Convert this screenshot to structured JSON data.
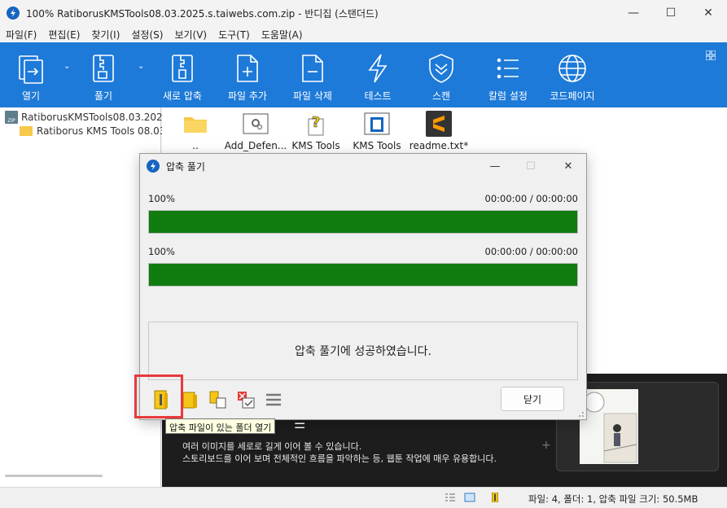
{
  "window": {
    "title": "100% RatiborusKMSTools08.03.2025.s.taiwebs.com.zip - 반디집 (스탠더드)",
    "minimize": "—",
    "maximize": "☐",
    "close": "✕"
  },
  "menu": [
    "파일(F)",
    "편집(E)",
    "찾기(I)",
    "설정(S)",
    "보기(V)",
    "도구(T)",
    "도움말(A)"
  ],
  "toolbar": {
    "open": "열기",
    "extract": "풀기",
    "new_archive": "새로 압축",
    "add_file": "파일 추가",
    "delete_file": "파일 삭제",
    "test": "테스트",
    "scan": "스캔",
    "columns": "칼럼 설정",
    "codepage": "코드페이지",
    "accent": "#1e7ad8"
  },
  "tree": {
    "root": "RatiborusKMSTools08.03.2025.",
    "child": "Ratiborus KMS Tools 08.03."
  },
  "files": [
    {
      "name": "..",
      "icon": "folder-icon"
    },
    {
      "name": "Add_Defen...",
      "icon": "settings-file-icon"
    },
    {
      "name": "KMS Tools",
      "icon": "help-file-icon"
    },
    {
      "name": "KMS Tools",
      "icon": "app-window-icon"
    },
    {
      "name": "readme.txt*",
      "icon": "sublime-icon"
    }
  ],
  "banner": {
    "line1": "여러 이미지를 세로로 길게 이어 볼 수 있습니다.",
    "line2": "스토리보드를 이어 보며 전체적인 흐름을 파악하는 등, 웹툰 작업에 매우 유용합니다.",
    "plus": "+"
  },
  "status": {
    "text": "파일: 4, 폴더: 1, 압축 파일 크기: 50.5MB"
  },
  "dialog": {
    "title": "압축 풀기",
    "progress1": {
      "percent_label": "100%",
      "time": "00:00:00 / 00:00:00",
      "value": 1.0
    },
    "progress2": {
      "percent_label": "100%",
      "time": "00:00:00 / 00:00:00",
      "value": 1.0
    },
    "message": "압축 풀기에 성공하였습니다.",
    "close_button": "닫기",
    "minimize": "—",
    "maximize": "☐",
    "close": "✕",
    "progress_color": "#107c10"
  },
  "tooltip": "압축 파일이 있는 폴더 열기"
}
